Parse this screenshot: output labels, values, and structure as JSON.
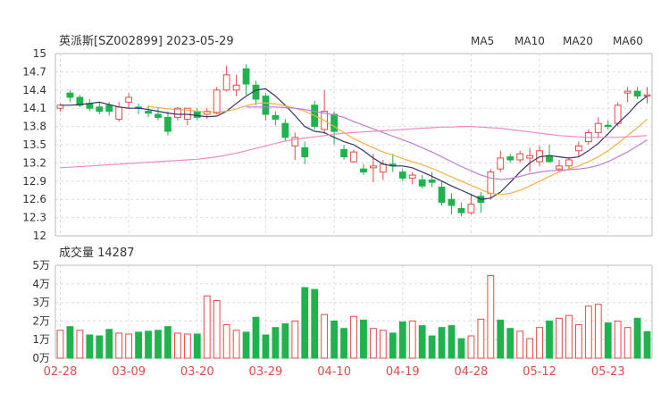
{
  "header": {
    "title": "英派斯[SZ002899] 2023-05-29",
    "ma_legend": [
      {
        "label": "MA5",
        "color": "#333366"
      },
      {
        "label": "MA10",
        "color": "#f5b041"
      },
      {
        "label": "MA20",
        "color": "#c27bd3"
      },
      {
        "label": "MA60",
        "color": "#f08ac7"
      }
    ]
  },
  "volume_title": "成交量 14287",
  "colors": {
    "up": "#e24a4a",
    "down": "#1eb34c"
  },
  "chart_data": [
    {
      "type": "candlestick",
      "ylim": [
        12,
        15
      ],
      "yticks": [
        "15",
        "14.7",
        "14.4",
        "14.1",
        "13.8",
        "13.5",
        "13.2",
        "12.9",
        "12.6",
        "12.3",
        "12"
      ],
      "dates": [
        "02-28",
        "03-01",
        "03-02",
        "03-03",
        "03-06",
        "03-07",
        "03-08",
        "03-09",
        "03-10",
        "03-13",
        "03-14",
        "03-15",
        "03-16",
        "03-17",
        "03-20",
        "03-21",
        "03-22",
        "03-23",
        "03-24",
        "03-27",
        "03-28",
        "03-29",
        "03-30",
        "03-31",
        "04-03",
        "04-04",
        "04-06",
        "04-07",
        "04-10",
        "04-11",
        "04-12",
        "04-13",
        "04-14",
        "04-17",
        "04-18",
        "04-19",
        "04-20",
        "04-21",
        "04-24",
        "04-25",
        "04-26",
        "04-27",
        "04-28",
        "05-04",
        "05-05",
        "05-08",
        "05-09",
        "05-10",
        "05-11",
        "05-12",
        "05-15",
        "05-16",
        "05-17",
        "05-18",
        "05-19",
        "05-22",
        "05-23",
        "05-24",
        "05-25",
        "05-26",
        "05-29"
      ],
      "x_tick_labels": [
        {
          "index": 0,
          "label": "02-28"
        },
        {
          "index": 7,
          "label": "03-09"
        },
        {
          "index": 14,
          "label": "03-20"
        },
        {
          "index": 21,
          "label": "03-29"
        },
        {
          "index": 28,
          "label": "04-10"
        },
        {
          "index": 35,
          "label": "04-19"
        },
        {
          "index": 42,
          "label": "04-28"
        },
        {
          "index": 49,
          "label": "05-12"
        },
        {
          "index": 56,
          "label": "05-23"
        }
      ],
      "ohlc": [
        [
          14.1,
          14.18,
          14.05,
          14.15
        ],
        [
          14.35,
          14.4,
          14.2,
          14.28
        ],
        [
          14.28,
          14.32,
          14.12,
          14.15
        ],
        [
          14.18,
          14.25,
          14.05,
          14.1
        ],
        [
          14.12,
          14.2,
          14.0,
          14.05
        ],
        [
          14.15,
          14.2,
          13.98,
          14.05
        ],
        [
          13.92,
          14.2,
          13.88,
          14.12
        ],
        [
          14.2,
          14.35,
          14.1,
          14.28
        ],
        [
          14.12,
          14.18,
          14.0,
          14.1
        ],
        [
          14.05,
          14.15,
          13.95,
          14.02
        ],
        [
          14.0,
          14.1,
          13.9,
          13.95
        ],
        [
          13.95,
          14.05,
          13.65,
          13.72
        ],
        [
          13.95,
          14.12,
          13.9,
          14.1
        ],
        [
          13.92,
          14.05,
          13.82,
          14.1
        ],
        [
          14.05,
          14.1,
          13.9,
          13.95
        ],
        [
          14.0,
          14.1,
          13.92,
          14.05
        ],
        [
          14.02,
          14.45,
          14.0,
          14.4
        ],
        [
          14.4,
          14.8,
          14.38,
          14.65
        ],
        [
          14.4,
          14.65,
          14.3,
          14.48
        ],
        [
          14.75,
          14.82,
          14.32,
          14.5
        ],
        [
          14.48,
          14.55,
          14.15,
          14.25
        ],
        [
          14.3,
          14.35,
          13.9,
          14.0
        ],
        [
          13.98,
          14.05,
          13.82,
          13.92
        ],
        [
          13.85,
          13.92,
          13.55,
          13.62
        ],
        [
          13.48,
          13.7,
          13.25,
          13.62
        ],
        [
          13.45,
          13.55,
          13.18,
          13.3
        ],
        [
          14.15,
          14.22,
          13.75,
          13.8
        ],
        [
          13.75,
          14.4,
          13.68,
          14.05
        ],
        [
          14.0,
          14.05,
          13.5,
          13.72
        ],
        [
          13.42,
          13.5,
          13.25,
          13.3
        ],
        [
          13.22,
          13.42,
          13.2,
          13.38
        ],
        [
          13.1,
          13.18,
          13.0,
          13.05
        ],
        [
          13.12,
          13.35,
          12.88,
          13.15
        ],
        [
          13.05,
          13.25,
          12.92,
          13.18
        ],
        [
          13.18,
          13.35,
          13.05,
          13.15
        ],
        [
          13.05,
          13.1,
          12.9,
          12.95
        ],
        [
          12.95,
          13.05,
          12.85,
          13.0
        ],
        [
          12.92,
          13.0,
          12.78,
          12.82
        ],
        [
          12.92,
          13.05,
          12.8,
          12.88
        ],
        [
          12.8,
          12.9,
          12.5,
          12.55
        ],
        [
          12.6,
          12.7,
          12.35,
          12.5
        ],
        [
          12.45,
          12.55,
          12.32,
          12.38
        ],
        [
          12.38,
          12.68,
          12.35,
          12.52
        ],
        [
          12.65,
          12.72,
          12.38,
          12.55
        ],
        [
          12.7,
          13.1,
          12.6,
          13.05
        ],
        [
          13.1,
          13.4,
          13.05,
          13.28
        ],
        [
          13.3,
          13.35,
          13.2,
          13.25
        ],
        [
          13.25,
          13.4,
          13.2,
          13.35
        ],
        [
          13.28,
          13.45,
          13.05,
          13.32
        ],
        [
          13.22,
          13.48,
          13.15,
          13.4
        ],
        [
          13.32,
          13.5,
          13.25,
          13.22
        ],
        [
          13.1,
          13.25,
          13.05,
          13.15
        ],
        [
          13.15,
          13.3,
          13.1,
          13.25
        ],
        [
          13.4,
          13.55,
          13.3,
          13.48
        ],
        [
          13.55,
          13.75,
          13.5,
          13.7
        ],
        [
          13.7,
          13.95,
          13.6,
          13.85
        ],
        [
          13.82,
          13.9,
          13.75,
          13.8
        ],
        [
          13.85,
          14.2,
          13.8,
          14.15
        ],
        [
          14.35,
          14.45,
          14.2,
          14.38
        ],
        [
          14.38,
          14.45,
          14.25,
          14.3
        ],
        [
          14.3,
          14.45,
          14.18,
          14.32
        ]
      ],
      "ma": {
        "MA5": [
          14.15,
          14.15,
          14.16,
          14.18,
          14.2,
          14.16,
          14.12,
          14.1,
          14.1,
          14.08,
          14.05,
          14.02,
          14.0,
          14.0,
          13.98,
          13.96,
          13.97,
          14.05,
          14.18,
          14.3,
          14.4,
          14.42,
          14.3,
          14.15,
          13.98,
          13.8,
          13.72,
          13.7,
          13.62,
          13.55,
          13.5,
          13.4,
          13.28,
          13.18,
          13.15,
          13.15,
          13.12,
          13.05,
          12.98,
          12.9,
          12.82,
          12.75,
          12.68,
          12.6,
          12.62,
          12.72,
          12.88,
          13.05,
          13.2,
          13.3,
          13.32,
          13.3,
          13.28,
          13.3,
          13.4,
          13.52,
          13.68,
          13.85,
          14.0,
          14.18,
          14.3
        ],
        "MA10": [
          null,
          null,
          null,
          null,
          null,
          null,
          null,
          null,
          null,
          14.13,
          14.11,
          14.09,
          14.08,
          14.07,
          14.05,
          14.04,
          14.04,
          14.05,
          14.09,
          14.14,
          14.18,
          14.19,
          14.17,
          14.14,
          14.1,
          14.05,
          13.98,
          13.9,
          13.8,
          13.7,
          13.6,
          13.52,
          13.45,
          13.38,
          13.33,
          13.27,
          13.22,
          13.17,
          13.11,
          13.04,
          12.97,
          12.9,
          12.83,
          12.76,
          12.7,
          12.68,
          12.7,
          12.75,
          12.82,
          12.9,
          12.98,
          13.05,
          13.1,
          13.15,
          13.22,
          13.3,
          13.4,
          13.52,
          13.65,
          13.78,
          13.92
        ],
        "MA20": [
          null,
          null,
          null,
          null,
          null,
          null,
          null,
          null,
          null,
          null,
          null,
          null,
          null,
          null,
          null,
          null,
          null,
          null,
          null,
          14.12,
          14.12,
          14.12,
          14.12,
          14.11,
          14.1,
          14.08,
          14.05,
          14.02,
          13.99,
          13.95,
          13.88,
          13.82,
          13.76,
          13.7,
          13.64,
          13.58,
          13.52,
          13.45,
          13.38,
          13.3,
          13.22,
          13.14,
          13.07,
          13.0,
          12.95,
          12.93,
          12.94,
          12.98,
          13.02,
          13.05,
          13.07,
          13.08,
          13.09,
          13.1,
          13.12,
          13.16,
          13.22,
          13.3,
          13.38,
          13.48,
          13.58
        ],
        "MA60": [
          13.12,
          13.13,
          13.14,
          13.15,
          13.16,
          13.17,
          13.18,
          13.19,
          13.2,
          13.21,
          13.22,
          13.23,
          13.24,
          13.25,
          13.26,
          13.28,
          13.3,
          13.33,
          13.36,
          13.4,
          13.44,
          13.48,
          13.52,
          13.56,
          13.59,
          13.61,
          13.63,
          13.65,
          13.67,
          13.69,
          13.7,
          13.71,
          13.72,
          13.73,
          13.74,
          13.75,
          13.76,
          13.77,
          13.78,
          13.79,
          13.79,
          13.8,
          13.8,
          13.79,
          13.78,
          13.77,
          13.75,
          13.73,
          13.71,
          13.69,
          13.67,
          13.65,
          13.64,
          13.63,
          13.62,
          13.62,
          13.62,
          13.62,
          13.63,
          13.64,
          13.65
        ]
      }
    },
    {
      "type": "bar",
      "title": "成交量 14287",
      "ylim": [
        0,
        50000
      ],
      "yticks": [
        "5万",
        "4万",
        "3万",
        "2万",
        "1万",
        "0万"
      ],
      "values": [
        15000,
        17000,
        15000,
        12500,
        12000,
        15500,
        13500,
        13000,
        14000,
        14500,
        15000,
        17000,
        13500,
        13000,
        13000,
        33500,
        31000,
        18000,
        15000,
        14000,
        22000,
        12500,
        16500,
        18500,
        20000,
        38000,
        37000,
        23500,
        20000,
        16000,
        22500,
        20500,
        16000,
        15000,
        13500,
        19500,
        20000,
        17500,
        12000,
        16500,
        17500,
        10500,
        12000,
        21000,
        44500,
        20500,
        16000,
        14500,
        10500,
        16500,
        20000,
        21500,
        23000,
        18000,
        28000,
        29000,
        19000,
        20000,
        16500,
        21500,
        14287
      ],
      "up": [
        true,
        false,
        true,
        false,
        false,
        false,
        true,
        true,
        false,
        false,
        false,
        false,
        true,
        true,
        false,
        true,
        true,
        true,
        true,
        false,
        false,
        false,
        false,
        false,
        true,
        false,
        false,
        true,
        false,
        false,
        true,
        false,
        true,
        true,
        false,
        false,
        true,
        false,
        false,
        false,
        false,
        false,
        true,
        true,
        true,
        false,
        false,
        true,
        true,
        true,
        false,
        true,
        true,
        true,
        true,
        true,
        false,
        true,
        true,
        false,
        false
      ]
    }
  ]
}
